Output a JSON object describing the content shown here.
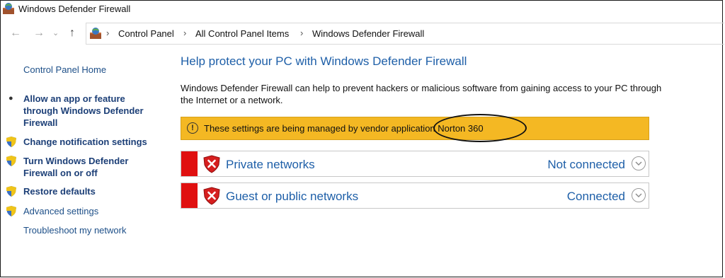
{
  "window": {
    "title": "Windows Defender Firewall"
  },
  "address_bar": {
    "breadcrumbs": [
      "Control Panel",
      "All Control Panel Items",
      "Windows Defender Firewall"
    ]
  },
  "left_pane": {
    "home": "Control Panel Home",
    "allow_app": "Allow an app or feature through Windows Defender Firewall",
    "change_notifications": "Change notification settings",
    "turn_on_off": "Turn Windows Defender Firewall on or off",
    "restore_defaults": "Restore defaults",
    "advanced_settings": "Advanced settings",
    "troubleshoot": "Troubleshoot my network"
  },
  "main": {
    "heading": "Help protect your PC with Windows Defender Firewall",
    "description": "Windows Defender Firewall can help to prevent hackers or malicious software from gaining access to your PC through the Internet or a network.",
    "banner": {
      "text": "These settings are being managed by vendor application Norton 360",
      "color": "#f4b823"
    },
    "networks": [
      {
        "label": "Private networks",
        "status": "Not connected"
      },
      {
        "label": "Guest or public networks",
        "status": "Connected"
      }
    ]
  },
  "colors": {
    "link": "#1e5fa8",
    "alert_red": "#e01010"
  }
}
